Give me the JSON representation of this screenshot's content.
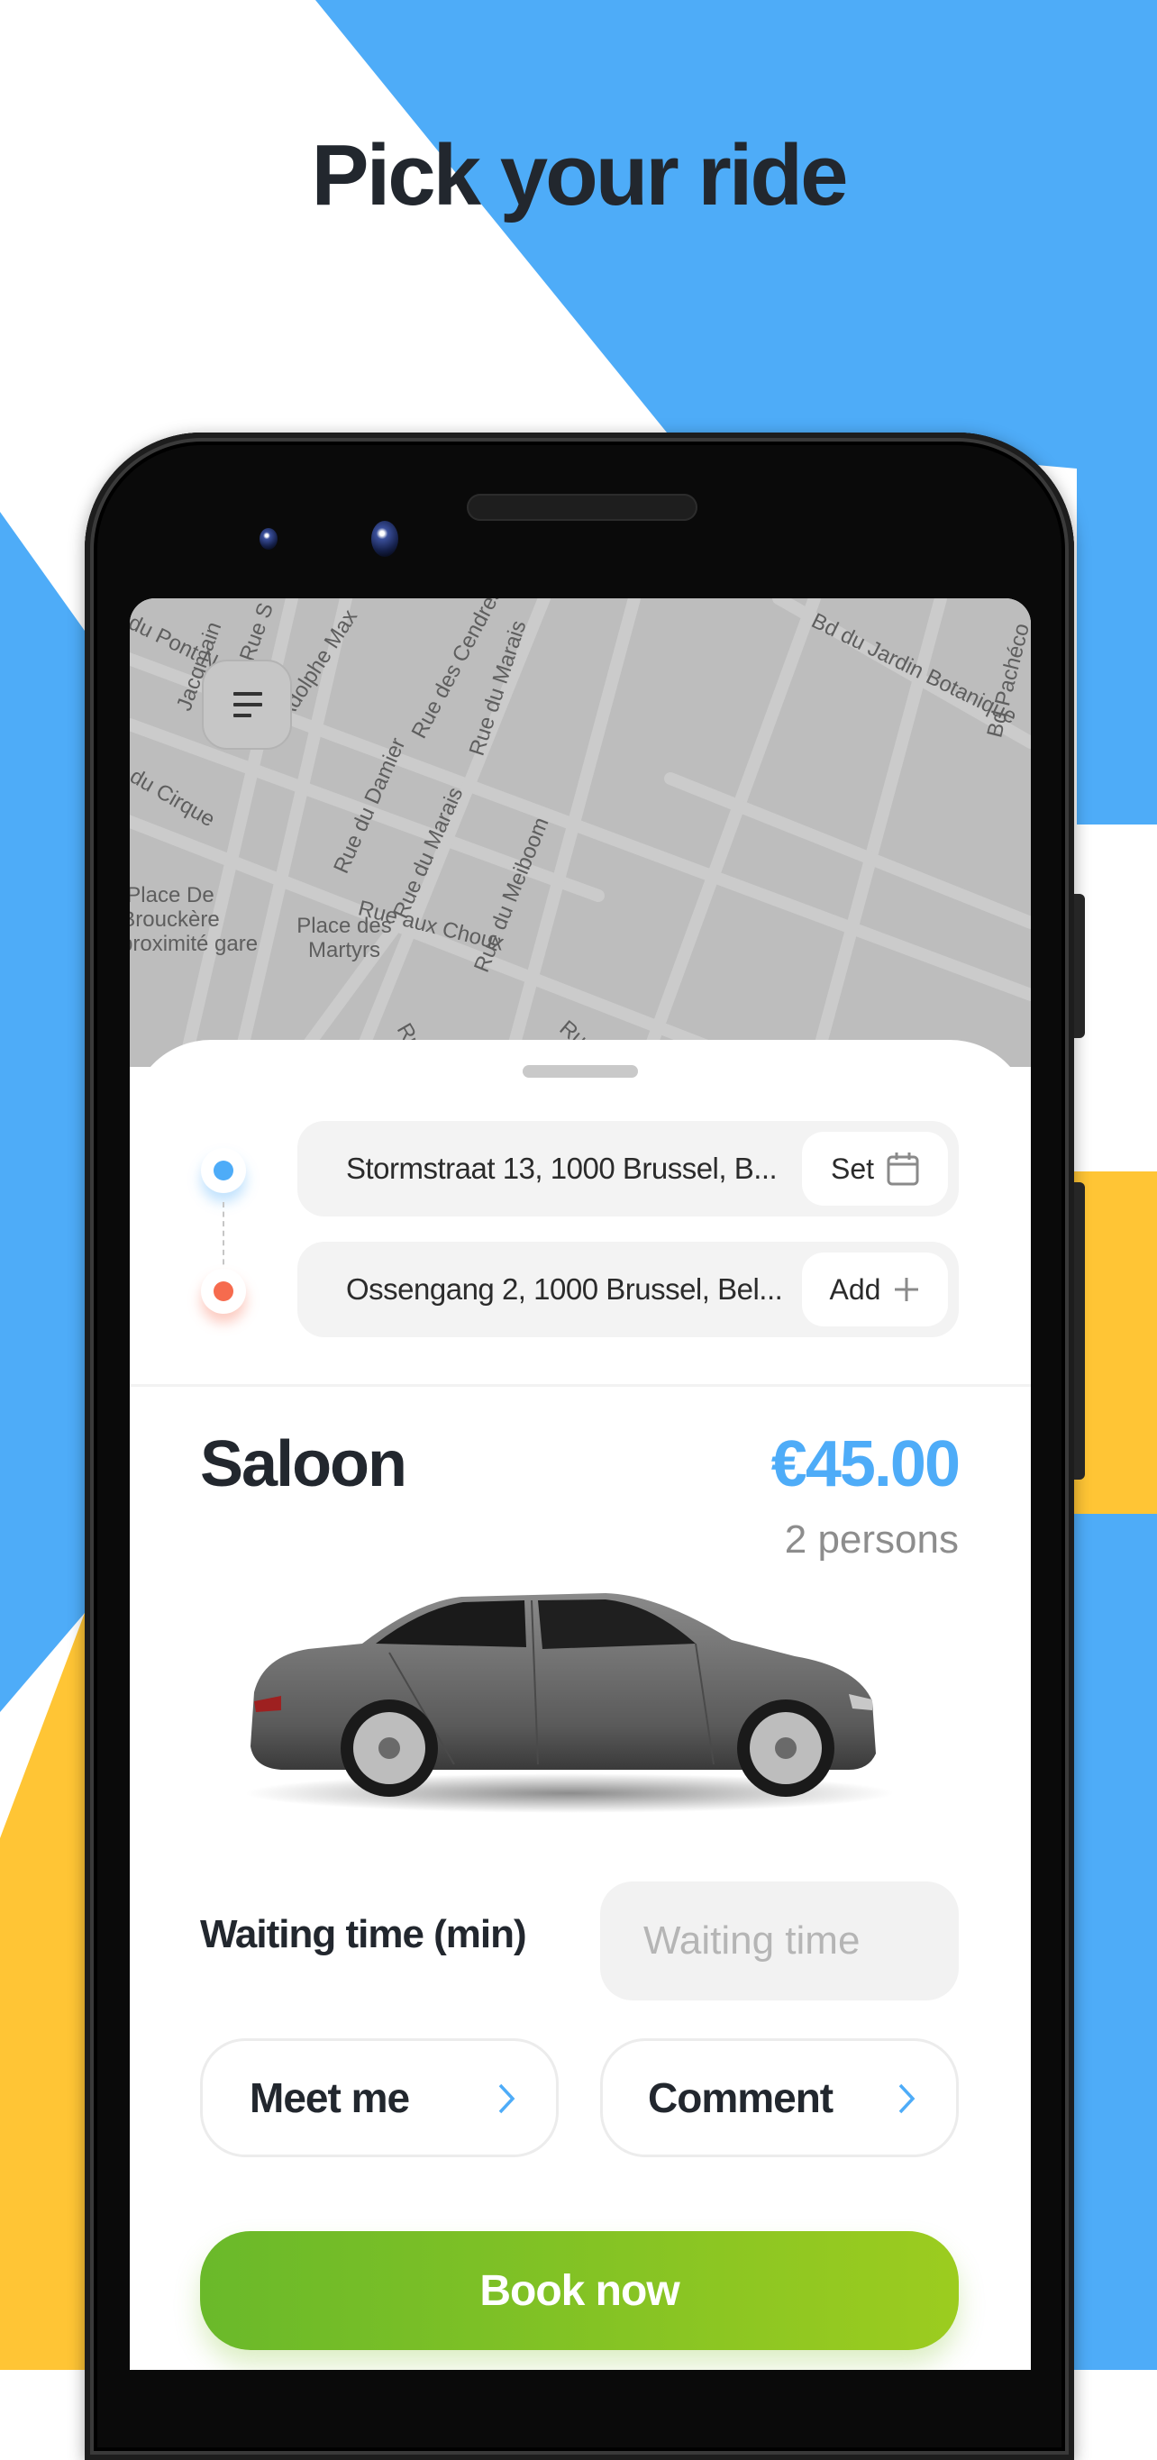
{
  "headline": "Pick your ride",
  "colors": {
    "brand_blue": "#4eacf8",
    "accent_yellow": "#ffc535",
    "book_green_start": "#6ab92a",
    "book_green_end": "#9ccc1f",
    "destination_red": "#f66b4e",
    "text_dark": "#22272e"
  },
  "map": {
    "menu_icon": "menu-icon",
    "labels": [
      "du Pont Neuf",
      "Jacqmain",
      "Rue S",
      "Bd Adolphe Max",
      "Rue des Cendres",
      "Bd du Jardin Botanique",
      "Rue du Marais",
      "du Cirque",
      "Rue du Damier",
      "Bd Pachéco",
      "Place De\nBrouckère\nproximité gare",
      "Rue aux Choux",
      "Rue du Marais",
      "Place des\nMartyrs",
      "Rue du Meiboom",
      "Rue du",
      "Rue des"
    ]
  },
  "route": {
    "pickup": {
      "address": "Stormstraat 13, 1000 Brussel, B...",
      "action_label": "Set",
      "action_icon": "calendar-icon"
    },
    "destination": {
      "address": "Ossengang 2, 1000 Brussel, Bel...",
      "action_label": "Add",
      "action_icon": "plus-icon"
    }
  },
  "vehicle": {
    "name": "Saloon",
    "price": "€45.00",
    "capacity": "2 persons",
    "image": "grey-sedan-car"
  },
  "waiting_time": {
    "label": "Waiting time (min)",
    "value": "",
    "placeholder": "Waiting time"
  },
  "options": [
    {
      "label": "Meet me",
      "icon": "chevron-right-icon"
    },
    {
      "label": "Comment",
      "icon": "chevron-right-icon"
    }
  ],
  "book_button": {
    "label": "Book now"
  }
}
